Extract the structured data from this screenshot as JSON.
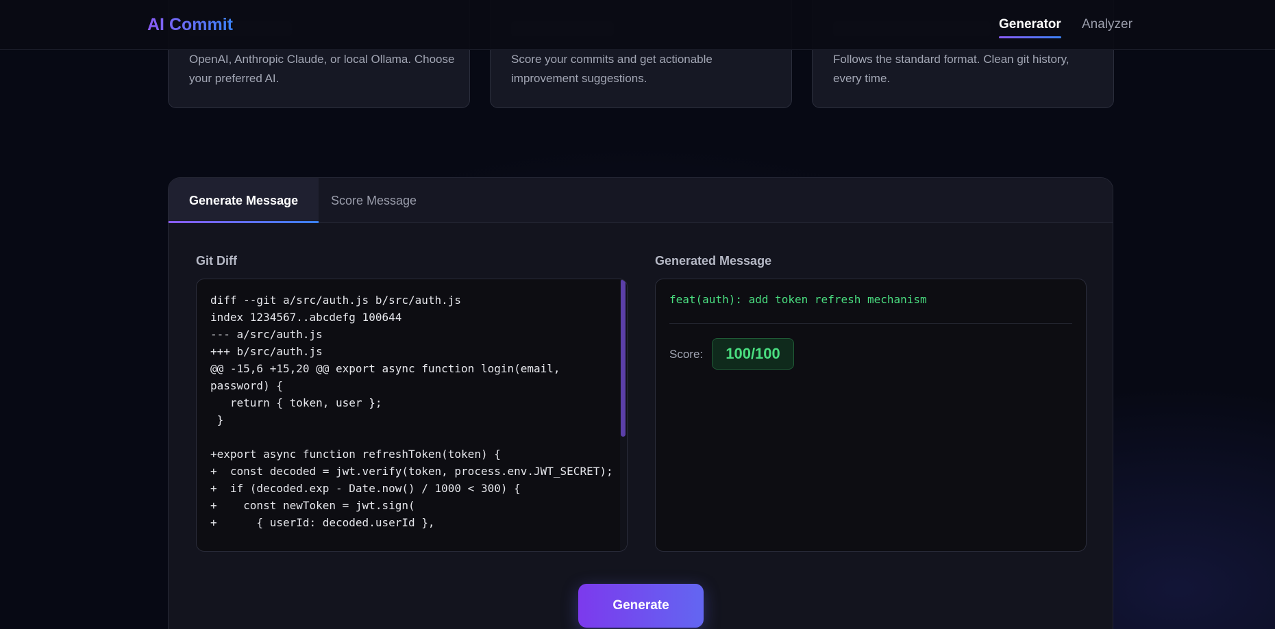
{
  "app": {
    "logo": "AI Commit",
    "nav": [
      {
        "label": "Generator",
        "active": true
      },
      {
        "label": "Analyzer",
        "active": false
      }
    ]
  },
  "features": [
    {
      "description": "OpenAI, Anthropic Claude, or local Ollama. Choose your preferred AI."
    },
    {
      "description": "Score your commits and get actionable improvement suggestions."
    },
    {
      "description": "Follows the standard format. Clean git history, every time."
    }
  ],
  "tabs": [
    {
      "label": "Generate Message",
      "active": true
    },
    {
      "label": "Score Message",
      "active": false
    }
  ],
  "diff": {
    "label": "Git Diff",
    "content": "diff --git a/src/auth.js b/src/auth.js\nindex 1234567..abcdefg 100644\n--- a/src/auth.js\n+++ b/src/auth.js\n@@ -15,6 +15,20 @@ export async function login(email, password) {\n   return { token, user };\n }\n\n+export async function refreshToken(token) {\n+  const decoded = jwt.verify(token, process.env.JWT_SECRET);\n+  if (decoded.exp - Date.now() / 1000 < 300) {\n+    const newToken = jwt.sign(\n+      { userId: decoded.userId },"
  },
  "result": {
    "label": "Generated Message",
    "message": "feat(auth): add token refresh mechanism",
    "score_label": "Score:",
    "score": "100/100"
  },
  "actions": {
    "generate_label": "Generate"
  },
  "colors": {
    "accent_start": "#7c3aed",
    "accent_end": "#6366f1",
    "success": "#4ade80"
  }
}
